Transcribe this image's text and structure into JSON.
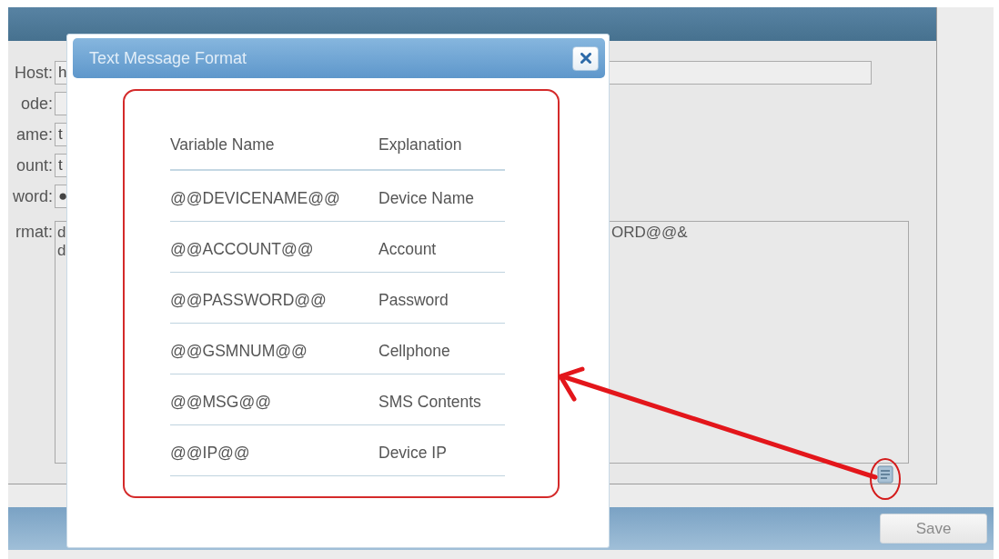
{
  "form": {
    "fields": [
      {
        "kind": "wide",
        "label": "Host:",
        "value": "h"
      },
      {
        "kind": "short",
        "label": "ode:"
      },
      {
        "kind": "short",
        "label": "ame:",
        "value": "t"
      },
      {
        "kind": "short",
        "label": "ount:",
        "value": "t"
      },
      {
        "kind": "short",
        "label": "word:",
        "value": "●"
      },
      {
        "kind": "area",
        "label": "rmat:",
        "lines": [
          {
            "start": "d",
            "end": "ORD@@&"
          },
          {
            "start": "d"
          }
        ]
      }
    ]
  },
  "dialog": {
    "title": "Text Message Format",
    "columns": [
      "Variable Name",
      "Explanation"
    ],
    "rows": [
      [
        "@@DEVICENAME@@",
        "Device Name"
      ],
      [
        "@@ACCOUNT@@",
        "Account"
      ],
      [
        "@@PASSWORD@@",
        "Password"
      ],
      [
        "@@GSMNUM@@",
        "Cellphone"
      ],
      [
        "@@MSG@@",
        "SMS Contents"
      ],
      [
        "@@IP@@",
        "Device IP"
      ]
    ]
  },
  "footer": {
    "buttons": [
      "Save"
    ]
  }
}
